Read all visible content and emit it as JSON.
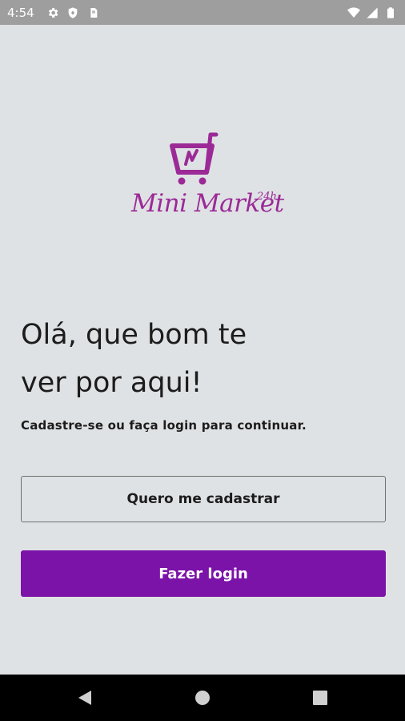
{
  "status_bar": {
    "time": "4:54",
    "left_icons": [
      "gear-icon",
      "shield-icon",
      "sim-card-icon"
    ],
    "right_icons": [
      "wifi-icon",
      "signal-icon",
      "battery-icon"
    ]
  },
  "logo": {
    "text": "Mini Market",
    "superscript": "24h",
    "color": "#9b2a97"
  },
  "greeting": {
    "line1": "Olá, que bom te",
    "line2": "ver por aqui!"
  },
  "subtitle": "Cadastre-se ou faça login para continuar.",
  "buttons": {
    "register": "Quero me cadastrar",
    "login": "Fazer login"
  },
  "colors": {
    "background": "#dfe2e4",
    "primary": "#7b13a8",
    "status_bar": "#9e9e9e"
  },
  "nav_bar": {
    "icons": [
      "back-icon",
      "home-icon",
      "recents-icon"
    ]
  }
}
